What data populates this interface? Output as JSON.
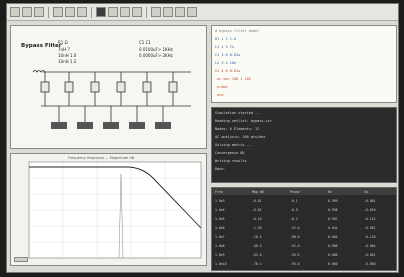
{
  "schematic": {
    "title": "Bypass Filter",
    "params": {
      "r1": "R1  Ω",
      "l1": "7nH 7",
      "l2": "10nH 1.0",
      "l3": "10nH 1.2",
      "c1": "C1  C1",
      "c2": "0.0100uF> 1KHz",
      "c3": "0.0000uF> 2KHz"
    }
  },
  "bode": {
    "title": "Frequency Response — Magnitude dB"
  },
  "code": {
    "lines": [
      "# bypass filter model",
      "R1 1 2 1.0",
      "L1 2 3 7n",
      "C1 3 0 0.01u",
      "L2 3 4 10n",
      "C2 4 0 0.01u",
      ".ac dec 100 1 10G",
      ".probe",
      ".end"
    ]
  },
  "console": {
    "lines": [
      "Simulation started ...",
      "Reading netlist: bypass.cir",
      "Nodes: 6   Elements: 12",
      "AC analysis: 100 pts/dec",
      "Solving matrix ...",
      "Convergence OK",
      "Writing results",
      "Done."
    ]
  },
  "table": {
    "headers": [
      "Freq",
      "Mag dB",
      "Phase",
      "Re",
      "Im"
    ],
    "rows": [
      [
        "1.0e3",
        "-0.01",
        "-0.1",
        "0.999",
        "-0.001"
      ],
      [
        "1.0e4",
        "-0.02",
        "-0.9",
        "0.998",
        "-0.016"
      ],
      [
        "1.0e5",
        "-0.10",
        "-8.2",
        "0.987",
        "-0.142"
      ],
      [
        "1.0e6",
        "-1.20",
        "-42.0",
        "0.644",
        "-0.581"
      ],
      [
        "1.0e7",
        "-18.4",
        "-88.0",
        "0.004",
        "-0.120"
      ],
      [
        "1.0e8",
        "-46.9",
        "-92.0",
        "0.000",
        "-0.004"
      ],
      [
        "1.0e9",
        "-62.0",
        "-94.5",
        "0.000",
        "-0.001"
      ],
      [
        "1.0e10",
        "-70.1",
        "-95.0",
        "0.000",
        "-0.000"
      ]
    ]
  },
  "colors": {
    "accent": "#c04a2a",
    "console_bg": "#2b2b2b",
    "panel_bg": "#f6f6f2"
  }
}
